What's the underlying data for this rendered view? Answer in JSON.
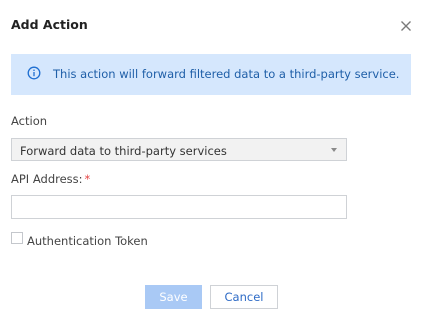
{
  "dialog": {
    "title": "Add Action",
    "info_text": "This action will forward filtered data to a third-party service."
  },
  "form": {
    "action_label": "Action",
    "action_value": "Forward data to third-party services",
    "api_address_label": "API Address:",
    "api_address_required_mark": "*",
    "api_address_value": "",
    "auth_token_label": "Authentication Token",
    "auth_token_checked": false
  },
  "buttons": {
    "save_label": "Save",
    "cancel_label": "Cancel"
  },
  "icons": {
    "close": "close-icon",
    "info": "info-circle-icon",
    "dropdown": "caret-down-icon"
  },
  "colors": {
    "info_background": "#d5e7fd",
    "info_text": "#1f5fa8",
    "primary_disabled": "#a9c9f5",
    "link_blue": "#2e6bc6",
    "required_red": "#e54545"
  }
}
